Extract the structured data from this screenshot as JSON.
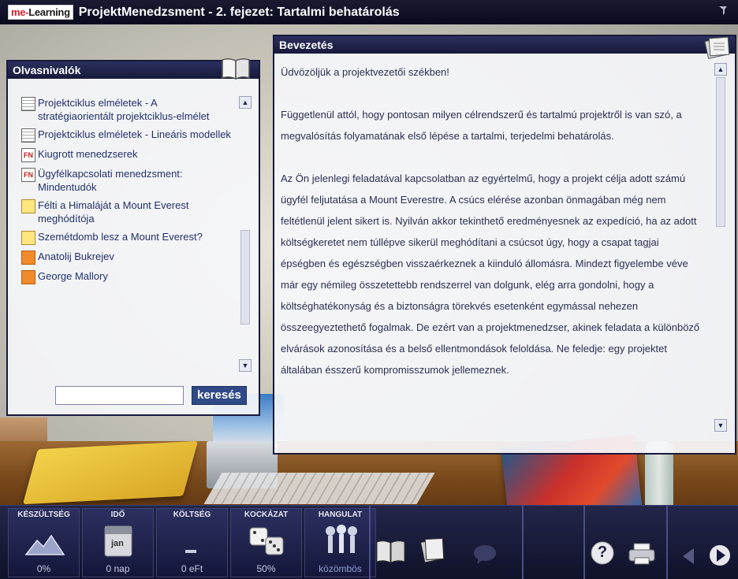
{
  "titlebar": {
    "brand_me": "me-",
    "brand_learning": "Learning",
    "title": "ProjektMenedzsment - 2. fejezet: Tartalmi behatárolás"
  },
  "reading_panel": {
    "header": "Olvasnivalók",
    "items": [
      {
        "icon": "document-icon",
        "label": "Projektciklus elméletek - A stratégiaorientált projektciklus-elmélet"
      },
      {
        "icon": "document-icon",
        "label": "Projektciklus elméletek - Lineáris modellek"
      },
      {
        "icon": "fn-article-icon",
        "label": "Kiugrott menedzserek"
      },
      {
        "icon": "fn-article-icon",
        "label": "Ügyfélkapcsolati menedzsment: Mindentudók"
      },
      {
        "icon": "video-icon",
        "label": "Félti a Himaláját a Mount Everest meghódítója"
      },
      {
        "icon": "video-icon",
        "label": "Szemétdomb lesz a Mount Everest?"
      },
      {
        "icon": "person-icon",
        "label": "Anatolij Bukrejev"
      },
      {
        "icon": "person-icon",
        "label": "George Mallory"
      }
    ],
    "search": {
      "value": "",
      "button_label": "keresés"
    }
  },
  "intro_panel": {
    "header": "Bevezetés",
    "paragraphs": [
      "Üdvözöljük a projektvezetői székben!",
      "Függetlenül attól, hogy pontosan milyen célrendszerű és tartalmú projektről is van szó, a megvalósítás folyamatának első lépése a tartalmi, terjedelmi behatárolás.",
      "Az Ön jelenlegi feladatával kapcsolatban az egyértelmű, hogy a projekt célja adott számú ügyfél feljutatása a Mount Everestre. A csúcs elérése azonban önmagában még nem feltétlenül jelent sikert is. Nyilván akkor tekinthető eredményesnek az expedíció, ha az adott költségkeretet nem túllépve sikerül meghódítani a csúcsot úgy, hogy a csapat tagjai épségben és egészségben visszaérkeznek a kiinduló állomásra. Mindezt figyelembe véve már egy némileg összetettebb rendszerrel van dolgunk, elég arra gondolni, hogy a költséghatékonyság és a biztonságra törekvés esetenként egymással nehezen összeegyeztethető fogalmak. De ezért van a projektmenedzser, akinek feladata a különböző elvárások azonosítása és a belső ellentmondások feloldása. Ne feledje: egy projektet általában ésszerű kompromisszumok jellemeznek."
    ]
  },
  "status": {
    "gauges": [
      {
        "label": "KÉSZÜLTSÉG",
        "value": "0%",
        "icon": "mountain-icon"
      },
      {
        "label": "IDŐ",
        "value": "0 nap",
        "icon": "calendar-icon",
        "calendar_text": "jan"
      },
      {
        "label": "KÖLTSÉG",
        "value": "0 eFt",
        "icon": "cost-icon"
      },
      {
        "label": "KOCKÁZAT",
        "value": "50%",
        "icon": "dice-icon"
      },
      {
        "label": "HANGULAT",
        "value": "közömbös",
        "icon": "team-mood-icon"
      }
    ],
    "tools": [
      "book-icon",
      "notes-icon",
      "chat-icon",
      "help-icon",
      "print-icon",
      "back-arrow-icon",
      "forward-arrow-icon"
    ],
    "help_glyph": "?"
  },
  "colors": {
    "brand_red": "#d5202a",
    "panel_header": "#1f2346",
    "link_text": "#23306a",
    "search_button": "#2f4a86"
  }
}
